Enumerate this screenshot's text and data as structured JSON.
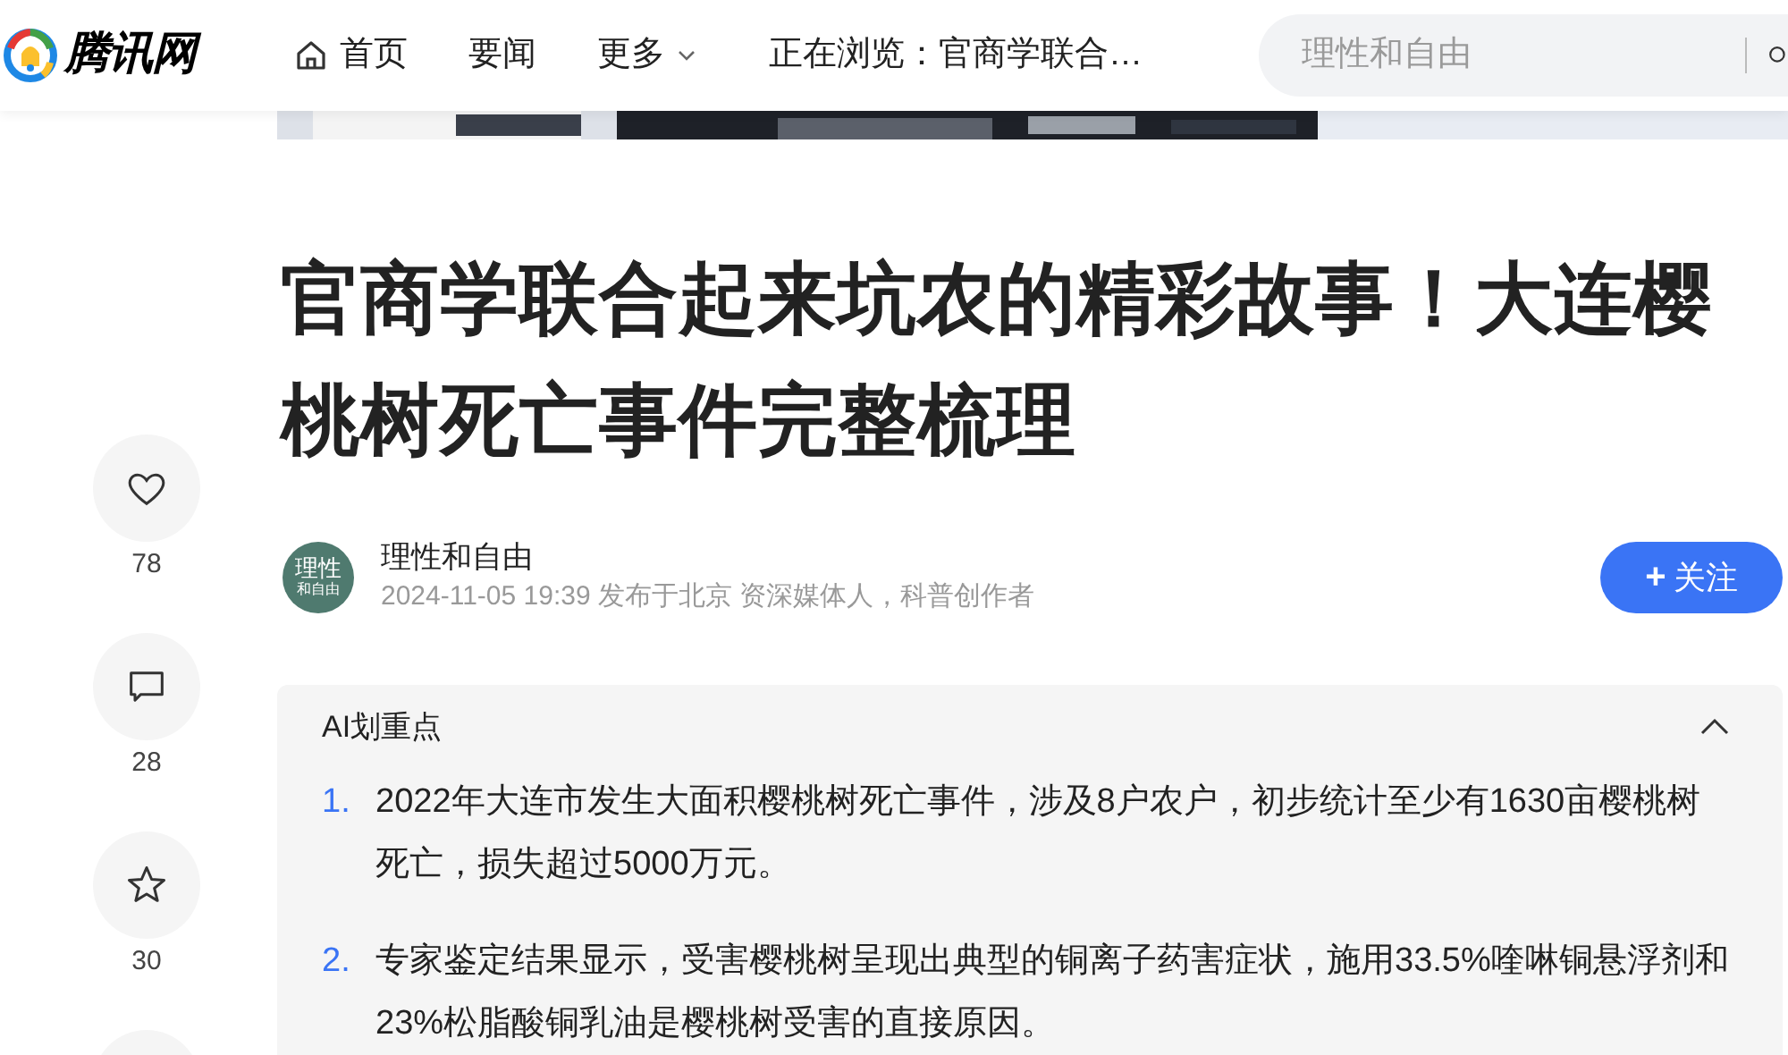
{
  "header": {
    "logo_text": "腾讯网",
    "nav": [
      {
        "kind": "home",
        "label": "首页"
      },
      {
        "kind": "plain",
        "label": "要闻"
      },
      {
        "kind": "dropdown",
        "label": "更多"
      }
    ],
    "now_browsing": "正在浏览：官商学联合…",
    "search": {
      "placeholder": "理性和自由"
    }
  },
  "article": {
    "title": "官商学联合起来坑农的精彩故事！大连樱桃树死亡事件完整梳理",
    "author": {
      "avatar_text": [
        "理性",
        "和自由"
      ],
      "name": "理性和自由",
      "meta": "2024-11-05 19:39 发布于北京 资深媒体人，科普创作者"
    },
    "follow_button": {
      "icon": "+",
      "label": "关注"
    }
  },
  "actions": [
    {
      "kind": "like",
      "count": "78"
    },
    {
      "kind": "comment",
      "count": "28"
    },
    {
      "kind": "favorite",
      "count": "30"
    },
    {
      "kind": "cut"
    }
  ],
  "ai_summary": {
    "title": "AI划重点",
    "expanded": true,
    "points": [
      {
        "number": "1.",
        "text": "2022年大连市发生大面积樱桃树死亡事件，涉及8户农户，初步统计至少有1630亩樱桃树死亡，损失超过5000万元。"
      },
      {
        "number": "2.",
        "text": "专家鉴定结果显示，受害樱桃树呈现出典型的铜离子药害症状，施用33.5%喹啉铜悬浮剂和23%松脂酸铜乳油是樱桃树受害的直接原因。"
      }
    ]
  }
}
